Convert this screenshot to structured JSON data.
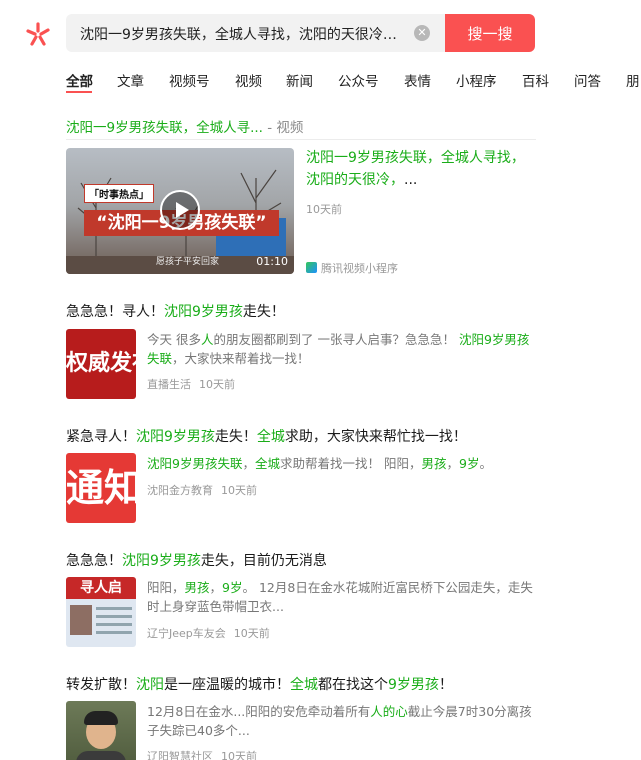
{
  "search": {
    "query": "沈阳一9岁男孩失联，全城人寻找，沈阳的天很冷，...",
    "button_label": "搜一搜"
  },
  "tabs": [
    "全部",
    "文章",
    "视频号",
    "视频",
    "新闻",
    "公众号",
    "表情",
    "小程序",
    "百科",
    "问答",
    "朋"
  ],
  "video": {
    "header_highlight": "沈阳一9岁男孩失联，全城人寻...",
    "header_source": " - 视频",
    "title_hl1": "沈阳一9岁男孩失联，全城人寻找，沈阳的天很冷，",
    "title_rest": "...",
    "time": "10天前",
    "source": "腾讯视频小程序",
    "thumb_tag": "「时事热点」",
    "thumb_banner": "“沈阳一9岁男孩失联”",
    "thumb_sub": "愿孩子平安回家",
    "duration": "01:10"
  },
  "articles": [
    {
      "title": [
        [
          "急急急！寻人！",
          false
        ],
        [
          "沈阳9岁男孩",
          true
        ],
        [
          "走失！",
          false
        ]
      ],
      "desc": [
        [
          "今天 很多",
          false
        ],
        [
          "人",
          true
        ],
        [
          "的朋友圈都刷到了 一张寻人启事？急急急！ ",
          false
        ],
        [
          "沈阳9岁男孩失联",
          true
        ],
        [
          "，大家快来帮着找一找！",
          false
        ]
      ],
      "account": "直播生活",
      "time": "10天前",
      "thumb_text": "权威发布"
    },
    {
      "title": [
        [
          "紧急寻人！",
          false
        ],
        [
          "沈阳9岁男孩",
          true
        ],
        [
          "走失！",
          false
        ],
        [
          "全城",
          true
        ],
        [
          "求助，大家快来帮忙找一找！",
          false
        ]
      ],
      "desc": [
        [
          "沈阳9岁男孩失联",
          true
        ],
        [
          "，",
          false
        ],
        [
          "全城",
          true
        ],
        [
          "求助帮着找一找！ 阳阳，",
          false
        ],
        [
          "男孩",
          true
        ],
        [
          "，",
          false
        ],
        [
          "9岁",
          true
        ],
        [
          "。",
          false
        ]
      ],
      "account": "沈阳金方教育",
      "time": "10天前",
      "thumb_text": "通知"
    },
    {
      "title": [
        [
          "急急急！",
          false
        ],
        [
          "沈阳9岁男孩",
          true
        ],
        [
          "走失，目前仍无消息",
          false
        ]
      ],
      "desc": [
        [
          "阳阳，",
          false
        ],
        [
          "男孩",
          true
        ],
        [
          "，",
          false
        ],
        [
          "9岁",
          true
        ],
        [
          "。 12月8日在金水花城附近富民桥下公园走失，走失时上身穿蓝色带帽卫衣...",
          false
        ]
      ],
      "account": "辽宁Jeep车友会",
      "time": "10天前",
      "thumb_text": "寻人启"
    },
    {
      "title": [
        [
          "转发扩散！",
          false
        ],
        [
          "沈阳",
          true
        ],
        [
          "是一座温暖的城市！",
          false
        ],
        [
          "全城",
          true
        ],
        [
          "都在找这个",
          false
        ],
        [
          "9岁男孩",
          true
        ],
        [
          "！",
          false
        ]
      ],
      "desc": [
        [
          "12月8日在金水...阳阳的安危牵动着所有",
          false
        ],
        [
          "人的心",
          true
        ],
        [
          "截止今晨7时30分离孩子失踪已40多个...",
          false
        ]
      ],
      "account": "辽阳智慧社区",
      "time": "10天前",
      "thumb_text": ""
    }
  ]
}
